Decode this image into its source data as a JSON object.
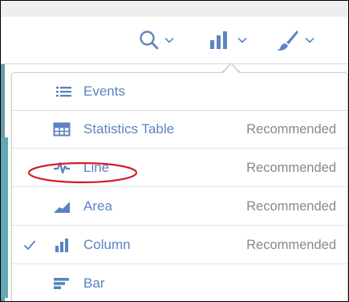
{
  "toolbar": {
    "buttons": [
      {
        "name": "search",
        "icon": "search-icon"
      },
      {
        "name": "visualization",
        "icon": "bar-chart-icon"
      },
      {
        "name": "format",
        "icon": "paintbrush-icon"
      }
    ]
  },
  "menu": {
    "items": [
      {
        "label": "Events",
        "icon": "list-icon",
        "recommended": "",
        "selected": false
      },
      {
        "label": "Statistics Table",
        "icon": "table-icon",
        "recommended": "Recommended",
        "selected": false
      },
      {
        "label": "Line",
        "icon": "line-chart-icon",
        "recommended": "Recommended",
        "selected": false
      },
      {
        "label": "Area",
        "icon": "area-chart-icon",
        "recommended": "Recommended",
        "selected": false
      },
      {
        "label": "Column",
        "icon": "column-chart-icon",
        "recommended": "Recommended",
        "selected": true
      },
      {
        "label": "Bar",
        "icon": "bar-horizontal-icon",
        "recommended": "",
        "selected": false
      }
    ]
  },
  "colors": {
    "accent": "#5a84c0",
    "muted_text": "#888888",
    "annotation": "#d0202a",
    "side_panel": "#63a9b5"
  }
}
